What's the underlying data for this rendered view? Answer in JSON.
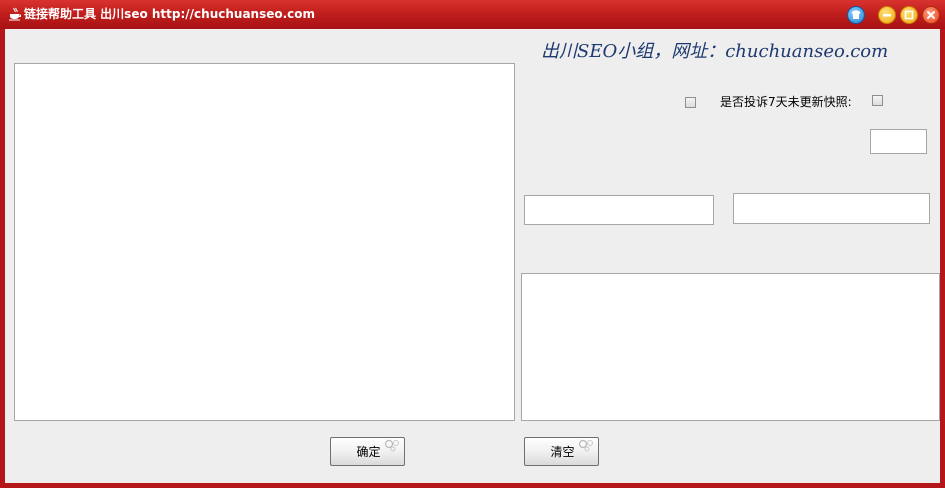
{
  "window": {
    "title": "链接帮助工具 出川seo http://chuchuanseo.com"
  },
  "header": {
    "brand_text": "出川SEO小组，网址：chuchuanseo.com"
  },
  "options": {
    "complain_label": "是否投诉7天未更新快照:"
  },
  "buttons": {
    "confirm": "确定",
    "clear": "清空"
  },
  "colors": {
    "titlebar": "#c11f1d",
    "window_frame": "#b5161a",
    "client_bg": "#eeeeee",
    "brand_text": "#1f3a70"
  },
  "icons": {
    "app": "java-cup-icon",
    "skin": "shirt-icon",
    "minimize": "minimize-icon",
    "maximize": "maximize-icon",
    "close": "close-icon"
  }
}
